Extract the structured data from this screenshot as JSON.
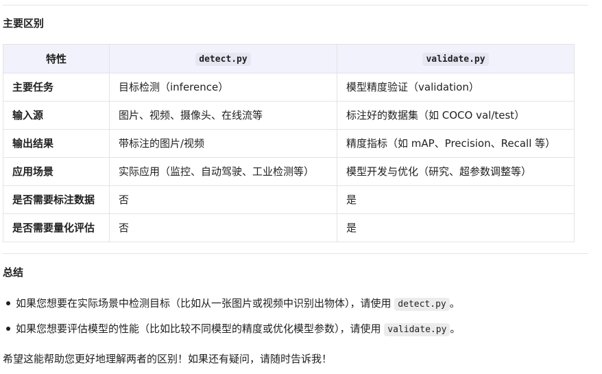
{
  "main_diff": {
    "title": "主要区别",
    "header": {
      "feature": "特性",
      "detect": "detect.py",
      "validate": "validate.py"
    },
    "rows": [
      {
        "feature": "主要任务",
        "detect": "目标检测（inference）",
        "validate": "模型精度验证（validation）"
      },
      {
        "feature": "输入源",
        "detect": "图片、视频、摄像头、在线流等",
        "validate": "标注好的数据集（如 COCO val/test）"
      },
      {
        "feature": "输出结果",
        "detect": "带标注的图片/视频",
        "validate": "精度指标（如 mAP、Precision、Recall 等）"
      },
      {
        "feature": "应用场景",
        "detect": "实际应用（监控、自动驾驶、工业检测等）",
        "validate": "模型开发与优化（研究、超参数调整等）"
      },
      {
        "feature": "是否需要标注数据",
        "detect": "否",
        "validate": "是"
      },
      {
        "feature": "是否需要量化评估",
        "detect": "否",
        "validate": "是"
      }
    ]
  },
  "summary": {
    "title": "总结",
    "bullets": [
      {
        "text": "如果您想要在实际场景中检测目标（比如从一张图片或视频中识别出物体），请使用",
        "code": "detect.py",
        "end": "。"
      },
      {
        "text": "如果您想要评估模型的性能（比如比较不同模型的精度或优化模型参数），请使用",
        "code": "validate.py",
        "end": "。"
      }
    ],
    "closing": "希望这能帮助您更好地理解两者的区别！如果还有疑问，请随时告诉我！"
  }
}
